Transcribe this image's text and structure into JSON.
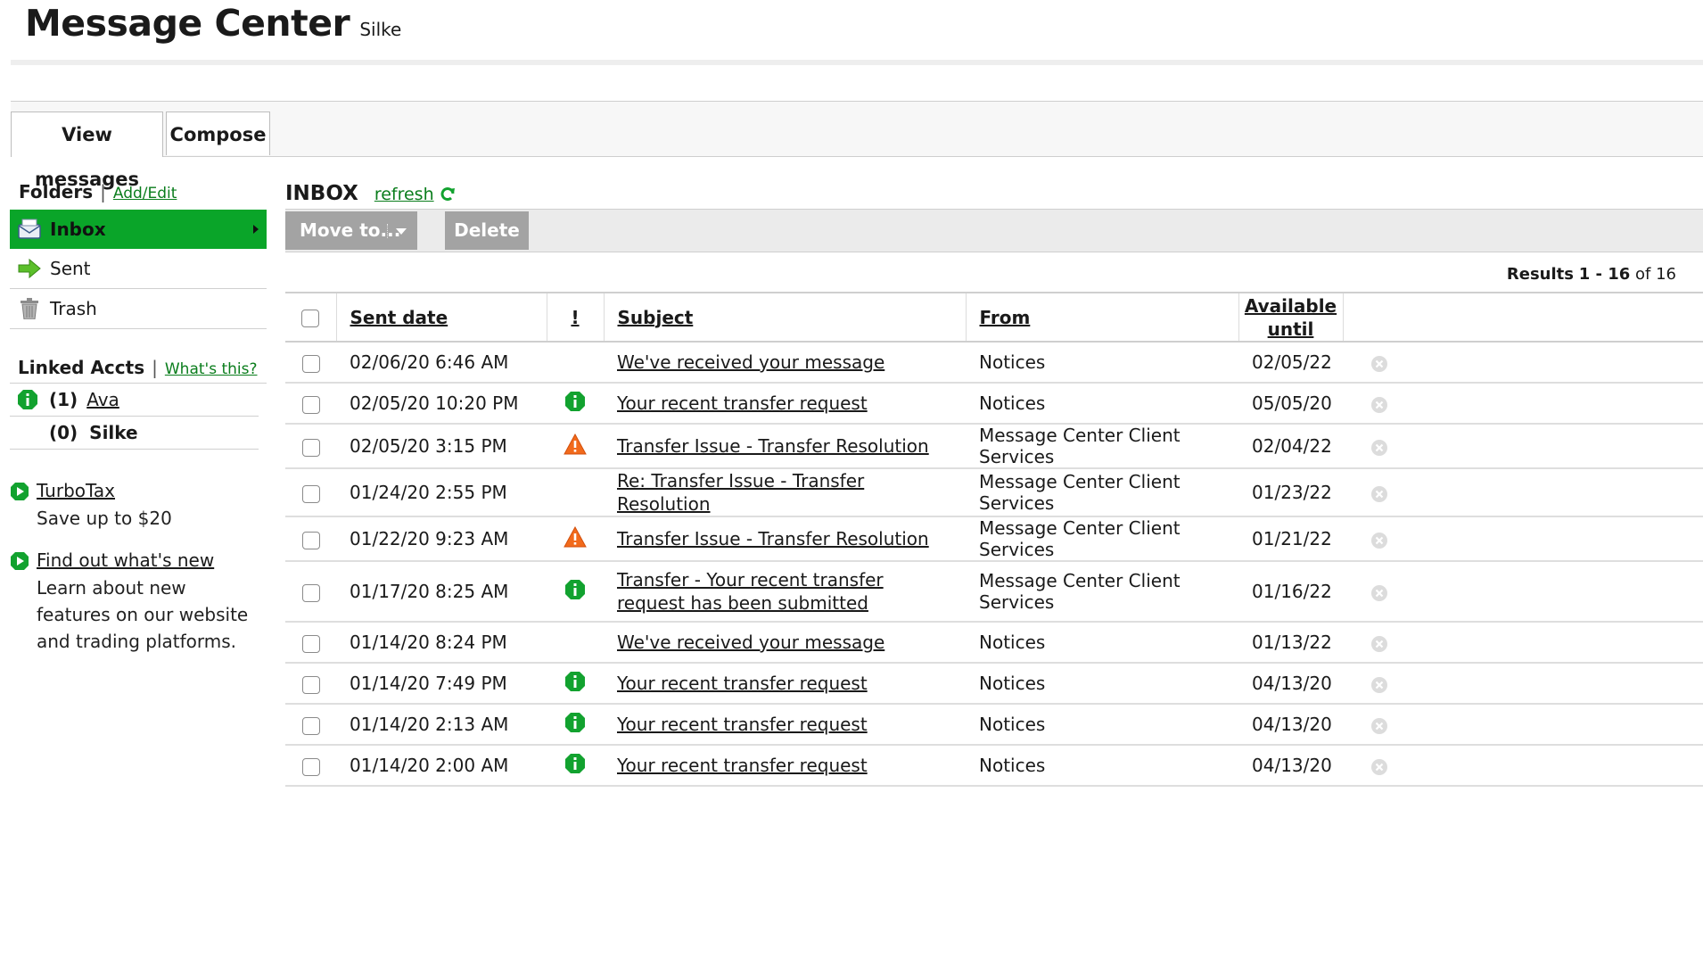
{
  "header": {
    "title": "Message Center",
    "user": "Silke"
  },
  "tabs": {
    "view": "View messages",
    "compose": "Compose"
  },
  "sidebar": {
    "folders_label": "Folders",
    "add_edit": "Add/Edit",
    "folders": [
      {
        "label": "Inbox",
        "icon": "inbox-icon"
      },
      {
        "label": "Sent",
        "icon": "sent-arrow-icon"
      },
      {
        "label": "Trash",
        "icon": "trash-icon"
      }
    ],
    "linked_label": "Linked Accts",
    "whats_this": "What's this?",
    "accounts": [
      {
        "count": "(1)",
        "name": "Ava"
      },
      {
        "count": "(0)",
        "name": "Silke"
      }
    ],
    "promos": [
      {
        "title": "TurboTax",
        "desc": "Save up to $20"
      },
      {
        "title": "Find out what's new",
        "desc": "Learn about new features on our website and trading platforms."
      }
    ]
  },
  "main": {
    "folder_title": "INBOX",
    "refresh": "refresh",
    "move_to": "Move to...",
    "delete": "Delete",
    "results": {
      "prefix": "Results",
      "range": "1 - 16",
      "of": "of 16"
    },
    "columns": {
      "sent": "Sent date",
      "imp": "!",
      "subject": "Subject",
      "from": "From",
      "avail1": "Available",
      "avail2": "until"
    },
    "rows": [
      {
        "date": "02/06/20 6:46 AM",
        "flag": "",
        "subject": "We've received your message",
        "from": "Notices",
        "until": "02/05/22"
      },
      {
        "date": "02/05/20 10:20 PM",
        "flag": "info",
        "subject": "Your recent transfer request",
        "from": "Notices",
        "until": "05/05/20"
      },
      {
        "date": "02/05/20 3:15 PM",
        "flag": "warn",
        "subject": "Transfer Issue - Transfer Resolution",
        "from": "Message Center Client Services",
        "until": "02/04/22"
      },
      {
        "date": "01/24/20 2:55 PM",
        "flag": "",
        "subject": "Re: Transfer Issue - Transfer Resolution",
        "from": "Message Center Client Services",
        "until": "01/23/22"
      },
      {
        "date": "01/22/20 9:23 AM",
        "flag": "warn",
        "subject": "Transfer Issue - Transfer Resolution",
        "from": "Message Center Client Services",
        "until": "01/21/22"
      },
      {
        "date": "01/17/20 8:25 AM",
        "flag": "info",
        "subject": "Transfer - Your recent transfer request has been submitted",
        "from": "Message Center Client Services",
        "until": "01/16/22"
      },
      {
        "date": "01/14/20 8:24 PM",
        "flag": "",
        "subject": "We've received your message",
        "from": "Notices",
        "until": "01/13/22"
      },
      {
        "date": "01/14/20 7:49 PM",
        "flag": "info",
        "subject": "Your recent transfer request",
        "from": "Notices",
        "until": "04/13/20"
      },
      {
        "date": "01/14/20 2:13 AM",
        "flag": "info",
        "subject": "Your recent transfer request",
        "from": "Notices",
        "until": "04/13/20"
      },
      {
        "date": "01/14/20 2:00 AM",
        "flag": "info",
        "subject": "Your recent transfer request",
        "from": "Notices",
        "until": "04/13/20"
      }
    ]
  },
  "colors": {
    "accent": "#0aa529",
    "link": "#0a7d1c",
    "warn": "#f26a1b",
    "button": "#a3a3a3"
  }
}
